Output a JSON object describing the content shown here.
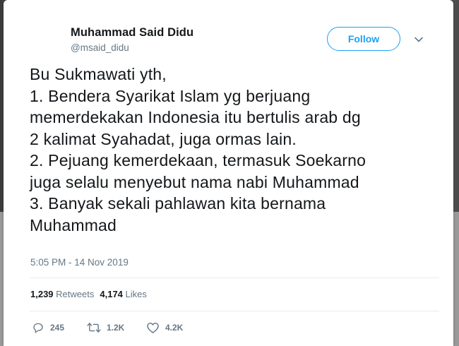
{
  "tweet": {
    "author_name": "Muhammad Said Didu",
    "author_handle": "@msaid_didu",
    "follow_label": "Follow",
    "text_lines": [
      "Bu Sukmawati yth,",
      "1. Bendera Syarikat Islam yg berjuang",
      "memerdekakan Indonesia itu bertulis arab dg",
      "2 kalimat Syahadat, juga ormas lain.",
      "2. Pejuang kemerdekaan, termasuk Soekarno",
      "juga selalu menyebut nama nabi Muhammad",
      "3. Banyak sekali pahlawan kita bernama",
      "Muhammad"
    ],
    "timestamp": "5:05 PM - 14 Nov 2019",
    "stats": {
      "retweets_count": "1,239",
      "retweets_label": "Retweets",
      "likes_count": "4,174",
      "likes_label": "Likes"
    },
    "actions": {
      "reply_count": "245",
      "retweet_count": "1.2K",
      "like_count": "4.2K"
    }
  },
  "icons": {
    "reply": "reply-icon",
    "retweet": "retweet-icon",
    "like": "heart-icon",
    "menu": "chevron-down-icon"
  },
  "colors": {
    "accent": "#1da1f2",
    "text": "#14171a",
    "muted": "#657786"
  }
}
